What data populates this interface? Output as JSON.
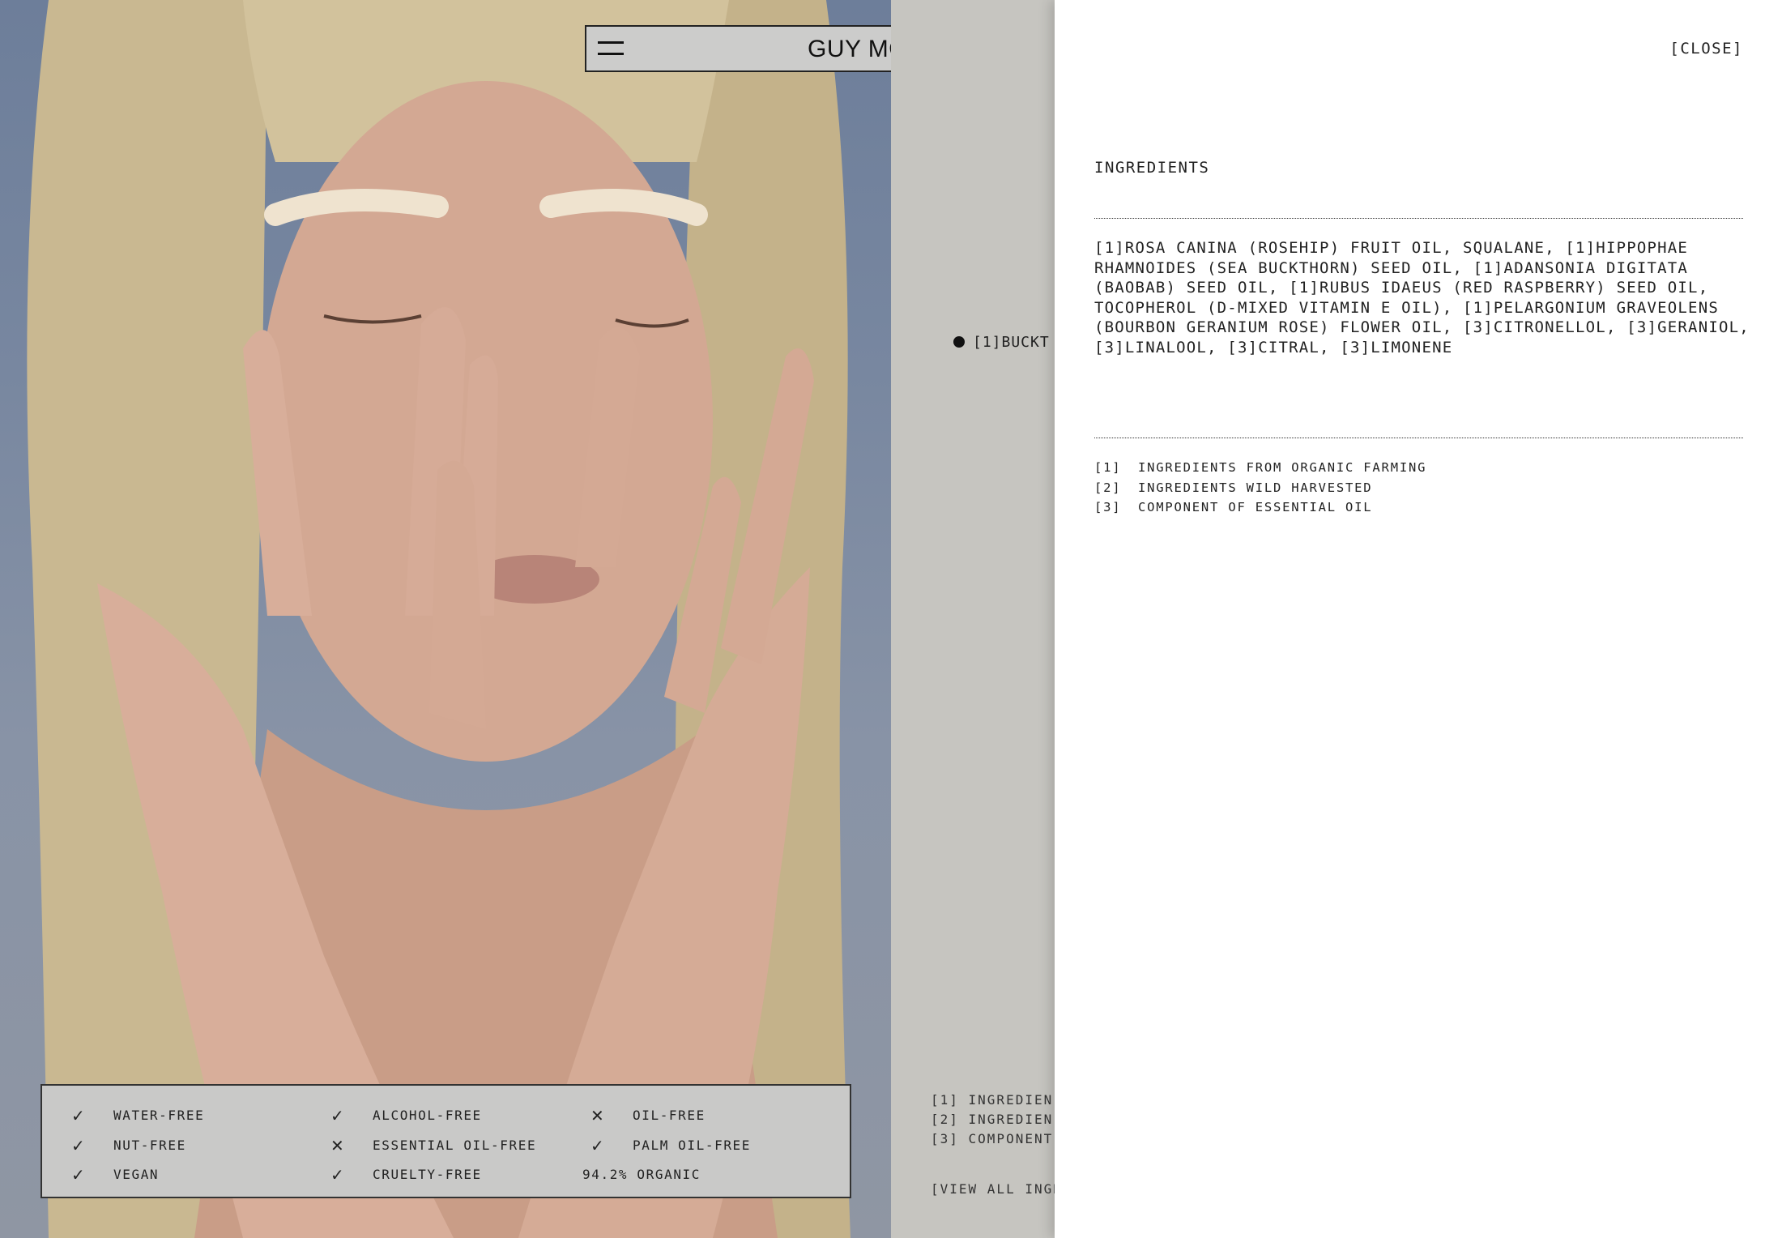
{
  "header": {
    "brand": "GUY MORGAN",
    "menu_icon": "hamburger-menu-icon"
  },
  "attributes": [
    {
      "icon": "check-icon",
      "mark": "✓",
      "label": "WATER-FREE"
    },
    {
      "icon": "check-icon",
      "mark": "✓",
      "label": "ALCOHOL-FREE"
    },
    {
      "icon": "cross-icon",
      "mark": "✕",
      "label": "OIL-FREE"
    },
    {
      "icon": "check-icon",
      "mark": "✓",
      "label": "NUT-FREE"
    },
    {
      "icon": "cross-icon",
      "mark": "✕",
      "label": "ESSENTIAL OIL-FREE"
    },
    {
      "icon": "check-icon",
      "mark": "✓",
      "label": "PALM OIL-FREE"
    },
    {
      "icon": "check-icon",
      "mark": "✓",
      "label": "VEGAN"
    },
    {
      "icon": "check-icon",
      "mark": "✓",
      "label": "CRUELTY-FREE"
    },
    {
      "icon": "",
      "mark": "",
      "label": "94.2% ORGANIC"
    }
  ],
  "strip": {
    "featured": "[1]BUCKT",
    "notes": [
      "[1]  INGREDIEN",
      "[2]  INGREDIEN",
      "[3]  COMPONENT"
    ],
    "view_all": "[VIEW ALL INGR"
  },
  "panel": {
    "close_label": "[CLOSE]",
    "title": "INGREDIENTS",
    "ingredients": "[1]ROSA CANINA (ROSEHIP) FRUIT OIL, SQUALANE, [1]HIPPOPHAE RHAMNOIDES (SEA BUCKTHORN) SEED OIL, [1]ADANSONIA DIGITATA (BAOBAB) SEED OIL, [1]RUBUS IDAEUS (RED RASPBERRY) SEED OIL, TOCOPHEROL (D-MIXED VITAMIN E OIL), [1]PELARGONIUM GRAVEOLENS (BOURBON GERANIUM ROSE) FLOWER OIL, [3]CITRONELLOL, [3]GERANIOL, [3]LINALOOL, [3]CITRAL, [3]LIMONENE",
    "legend": [
      {
        "key": "[1]",
        "text": "INGREDIENTS FROM ORGANIC FARMING"
      },
      {
        "key": "[2]",
        "text": "INGREDIENTS WILD HARVESTED"
      },
      {
        "key": "[3]",
        "text": "COMPONENT OF ESSENTIAL OIL"
      }
    ]
  }
}
